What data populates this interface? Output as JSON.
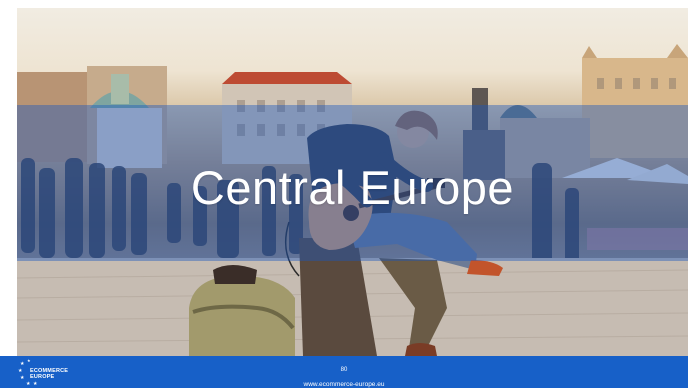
{
  "slide": {
    "title": "Central Europe",
    "page_number": "80",
    "url": "www.ecommerce-europe.eu",
    "logo": {
      "line1": "ECOMMERCE",
      "line2": "EUROPE"
    }
  },
  "photo": {
    "icon": "street-musician-photo-icon",
    "subjects": "street-musician-guitar-icon"
  },
  "colors": {
    "footer": "#1760c8",
    "band": "#1856be"
  }
}
